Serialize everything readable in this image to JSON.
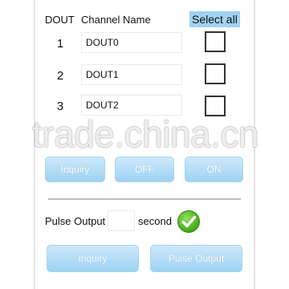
{
  "header": {
    "dout_label": "DOUT",
    "channel_label": "Channel Name",
    "select_all_label": "Select all"
  },
  "channels": [
    {
      "number": "1",
      "name": "DOUT0",
      "checked": false
    },
    {
      "number": "2",
      "name": "DOUT1",
      "checked": false
    },
    {
      "number": "3",
      "name": "DOUT2",
      "checked": false
    }
  ],
  "watermark": "trade.china.cn",
  "controls": {
    "inquiry_label": "Inquiry",
    "off_label": "OFF",
    "on_label": "ON"
  },
  "pulse": {
    "output_label": "Pulse Output",
    "duration_value": "",
    "unit_label": "second",
    "confirm_icon": "check-circle-icon",
    "inquiry_label": "Inquiry",
    "pulse_button_label": "Pulse Output"
  },
  "colors": {
    "button_gradient_top": "#cfe9fb",
    "button_gradient_bottom": "#9dd2f3",
    "select_all_highlight": "#9fd3f1",
    "confirm_green": "#3fa516"
  }
}
